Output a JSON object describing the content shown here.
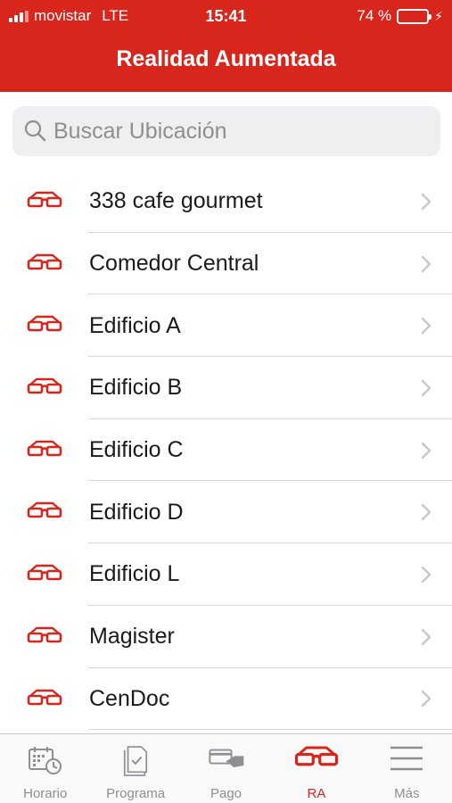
{
  "status_bar": {
    "carrier": "movistar",
    "network": "LTE",
    "time": "15:41",
    "battery_percent": "74 %",
    "battery_level": 0.74
  },
  "nav": {
    "title": "Realidad Aumentada"
  },
  "search": {
    "placeholder": "Buscar Ubicación",
    "value": ""
  },
  "list": {
    "items": [
      {
        "label": "338 cafe gourmet",
        "icon": "ar-glasses-icon"
      },
      {
        "label": "Comedor Central",
        "icon": "ar-glasses-icon"
      },
      {
        "label": "Edificio A",
        "icon": "ar-glasses-icon"
      },
      {
        "label": "Edificio B",
        "icon": "ar-glasses-icon"
      },
      {
        "label": "Edificio C",
        "icon": "ar-glasses-icon"
      },
      {
        "label": "Edificio D",
        "icon": "ar-glasses-icon"
      },
      {
        "label": "Edificio L",
        "icon": "ar-glasses-icon"
      },
      {
        "label": "Magister",
        "icon": "ar-glasses-icon"
      },
      {
        "label": "CenDoc",
        "icon": "ar-glasses-icon"
      }
    ]
  },
  "tab_bar": {
    "tabs": [
      {
        "label": "Horario",
        "icon": "calendar-clock-icon",
        "active": false
      },
      {
        "label": "Programa",
        "icon": "document-check-icon",
        "active": false
      },
      {
        "label": "Pago",
        "icon": "card-payment-icon",
        "active": false
      },
      {
        "label": "RA",
        "icon": "ar-glasses-icon",
        "active": true
      },
      {
        "label": "Más",
        "icon": "menu-icon",
        "active": false
      }
    ]
  },
  "colors": {
    "brand_red": "#d9261c",
    "battery_green": "#4cd964",
    "inactive_gray": "#8e8e93"
  }
}
